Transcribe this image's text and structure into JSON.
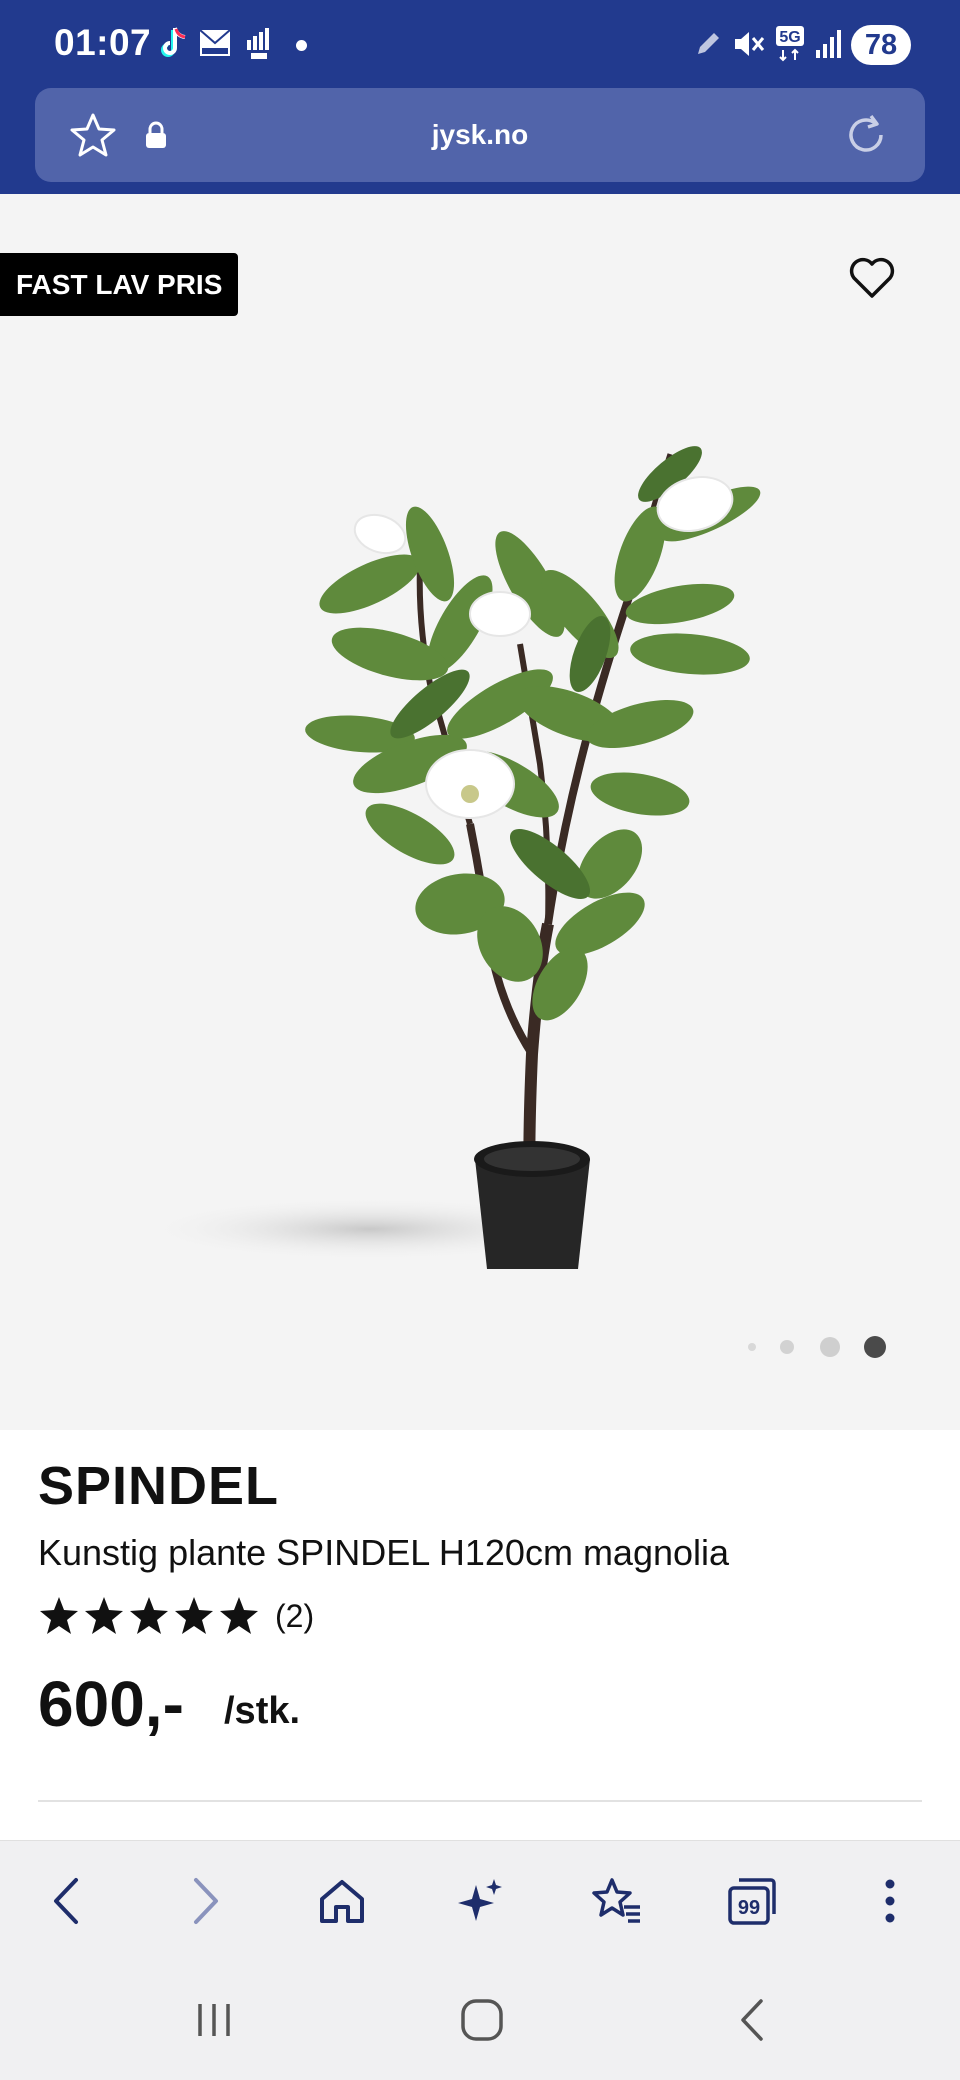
{
  "status_bar": {
    "time": "01:07",
    "battery": "78",
    "network": "5G"
  },
  "browser": {
    "url": "jysk.no"
  },
  "product": {
    "badge": "FAST LAV PRIS",
    "brand": "SPINDEL",
    "description": "Kunstig plante SPINDEL H120cm magnolia",
    "rating": 5,
    "review_count": "(2)",
    "price": "600,-",
    "unit": "/stk.",
    "gallery_index": 4,
    "gallery_total": 4
  },
  "toolbar": {
    "buttons": [
      "back-icon",
      "forward-icon",
      "home-icon",
      "sparkle-icon",
      "bookmarks-icon",
      "tabs-icon",
      "more-icon"
    ],
    "tabs_count": "99"
  },
  "colors": {
    "top_bar": "#223a8e",
    "url_bar": "#5164aa",
    "toolbar_icon": "#1e2d6b"
  }
}
